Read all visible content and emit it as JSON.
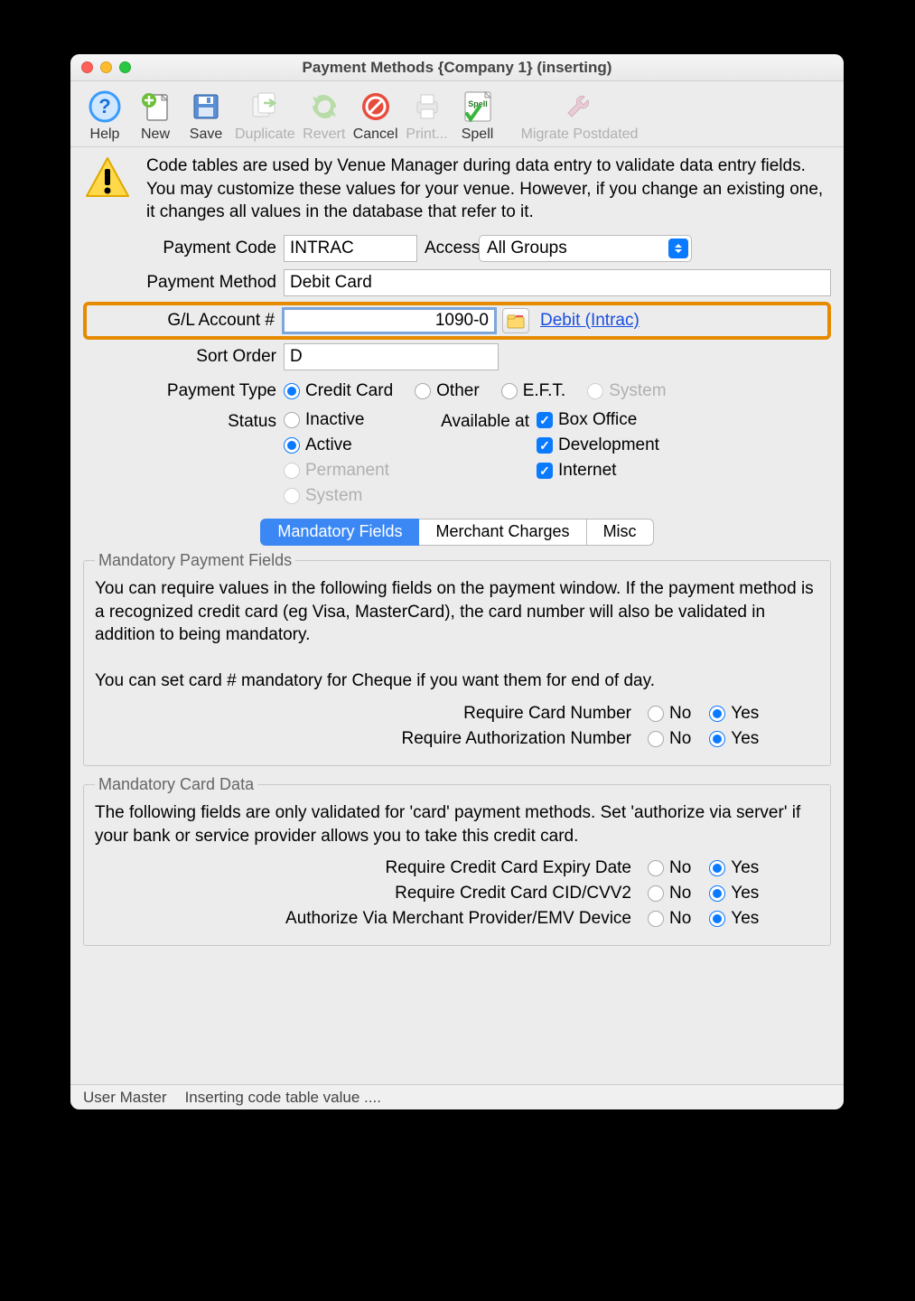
{
  "window": {
    "title": "Payment Methods {Company 1} (inserting)"
  },
  "toolbar": {
    "help": "Help",
    "new": "New",
    "save": "Save",
    "duplicate": "Duplicate",
    "revert": "Revert",
    "cancel": "Cancel",
    "print": "Print...",
    "spell": "Spell",
    "migrate": "Migrate Postdated"
  },
  "description": "Code tables are used by Venue Manager during data entry to validate data entry fields.  You may customize these values for your venue.  However, if you change an existing one, it changes all values in the database that refer to it.",
  "labels": {
    "payment_code": "Payment Code",
    "access": "Access",
    "payment_method": "Payment Method",
    "gl_account": "G/L Account #",
    "sort_order": "Sort Order",
    "payment_type": "Payment Type",
    "status": "Status",
    "available_at": "Available at"
  },
  "fields": {
    "payment_code": "INTRAC",
    "access": "All Groups",
    "payment_method": "Debit Card",
    "gl_account": "1090-0",
    "gl_link": "Debit (Intrac)",
    "sort_order": "D"
  },
  "payment_type": {
    "credit_card": "Credit Card",
    "other": "Other",
    "eft": "E.F.T.",
    "system": "System",
    "selected": "credit_card"
  },
  "status": {
    "inactive": "Inactive",
    "active": "Active",
    "permanent": "Permanent",
    "system": "System",
    "selected": "active"
  },
  "available_at": {
    "box_office": {
      "label": "Box Office",
      "checked": true
    },
    "development": {
      "label": "Development",
      "checked": true
    },
    "internet": {
      "label": "Internet",
      "checked": true
    }
  },
  "tabs": {
    "mandatory": "Mandatory Fields",
    "merchant": "Merchant Charges",
    "misc": "Misc"
  },
  "mandatory_payment": {
    "legend": "Mandatory Payment Fields",
    "desc": "You can require values in the following fields on the payment window.  If the payment method is a recognized credit card (eg Visa, MasterCard), the card number will also be validated in addition to being mandatory.\n\nYou can set card # mandatory for Cheque if you want them for end of day.",
    "require_card_number": "Require Card Number",
    "require_auth_number": "Require Authorization Number"
  },
  "mandatory_card": {
    "legend": "Mandatory Card Data",
    "desc": "The following fields are only validated for 'card' payment methods.  Set 'authorize via server' if your bank or service provider allows you to take this credit card.",
    "expiry": "Require Credit Card Expiry Date",
    "cvv": "Require Credit Card CID/CVV2",
    "authorize": "Authorize Via Merchant Provider/EMV Device"
  },
  "yes_no": {
    "no": "No",
    "yes": "Yes"
  },
  "statusbar": {
    "user": "User Master",
    "msg": "Inserting code table value ...."
  },
  "icons": {
    "spell_text": "Spell"
  }
}
